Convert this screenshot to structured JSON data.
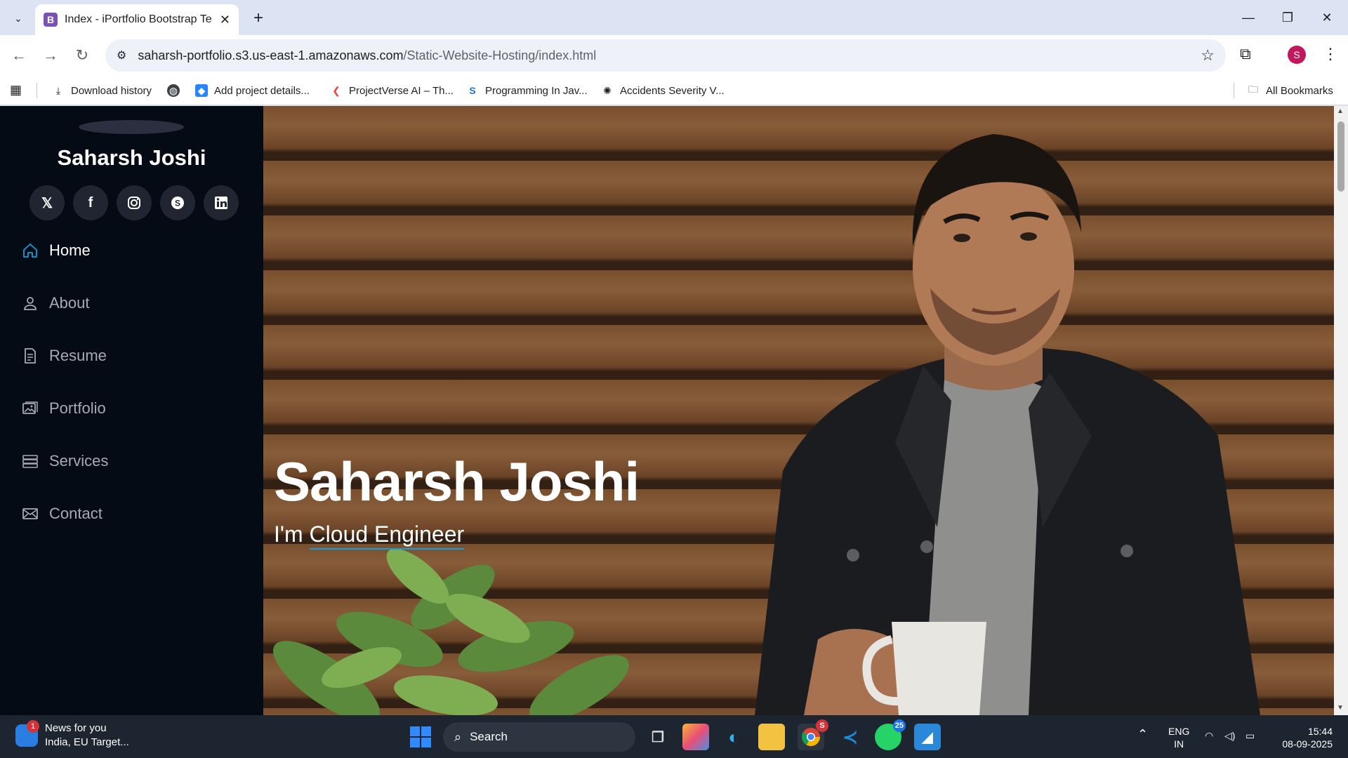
{
  "browser": {
    "tab_title": "Index - iPortfolio Bootstrap Tem",
    "tab_favicon": "B",
    "url_host": "saharsh-portfolio.s3.us-east-1.amazonaws.com",
    "url_path": "/Static-Website-Hosting/index.html",
    "profile_initial": "S"
  },
  "bookmarks": [
    {
      "label": "Download history",
      "icon": "download-icon"
    },
    {
      "label": "",
      "icon": "globe-icon"
    },
    {
      "label": "Add project details...",
      "icon": "jira-icon"
    },
    {
      "label": "ProjectVerse AI – Th...",
      "icon": "projectverse-icon"
    },
    {
      "label": "Programming In Jav...",
      "icon": "s-logo-icon"
    },
    {
      "label": "Accidents Severity V...",
      "icon": "openai-icon"
    }
  ],
  "all_bookmarks_label": "All Bookmarks",
  "sidebar": {
    "name": "Saharsh Joshi",
    "socials": [
      "x-icon",
      "facebook-icon",
      "instagram-icon",
      "skype-icon",
      "linkedin-icon"
    ],
    "nav": [
      {
        "label": "Home",
        "icon": "house-icon",
        "active": true
      },
      {
        "label": "About",
        "icon": "person-icon",
        "active": false
      },
      {
        "label": "Resume",
        "icon": "file-icon",
        "active": false
      },
      {
        "label": "Portfolio",
        "icon": "images-icon",
        "active": false
      },
      {
        "label": "Services",
        "icon": "server-icon",
        "active": false
      },
      {
        "label": "Contact",
        "icon": "envelope-icon",
        "active": false
      }
    ]
  },
  "hero": {
    "title": "Saharsh Joshi",
    "subtitle_prefix": "I'm",
    "subtitle_typed": "Cloud Engineer"
  },
  "taskbar": {
    "news_title": "News for you",
    "news_sub": "India, EU Target...",
    "news_badge": "1",
    "search_label": "Search",
    "chrome_badge": "S",
    "whatsapp_badge": "25",
    "lang_1": "ENG",
    "lang_2": "IN",
    "time": "15:44",
    "date": "08-09-2025"
  },
  "colors": {
    "accent": "#149ddd",
    "sidebar_bg": "#040b14",
    "social_bg": "#212431"
  }
}
